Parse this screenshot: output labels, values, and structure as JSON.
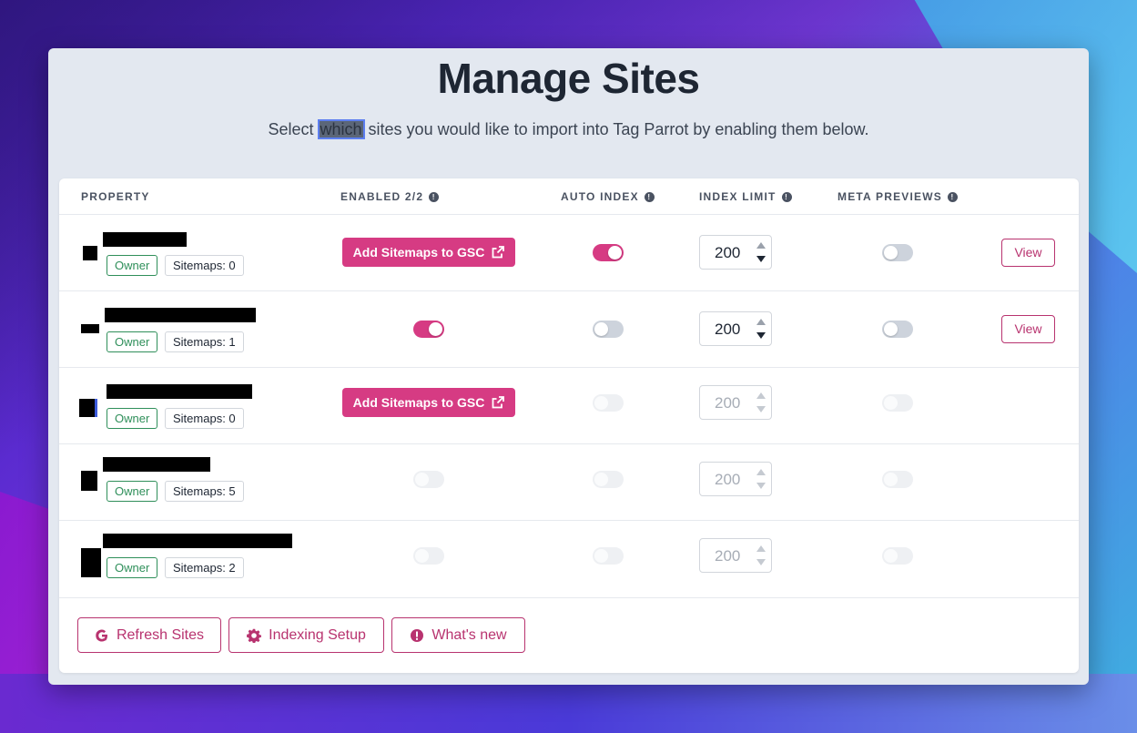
{
  "page": {
    "title": "Manage Sites",
    "subtitle_before": "Select ",
    "subtitle_highlight": "which",
    "subtitle_after": " sites you would like to import into Tag Parrot by enabling them below."
  },
  "table": {
    "headers": {
      "property": "PROPERTY",
      "enabled": "ENABLED 2/2",
      "auto_index": "AUTO INDEX",
      "index_limit": "INDEX LIMIT",
      "meta_previews": "META PREVIEWS"
    },
    "rows": [
      {
        "owner": "Owner",
        "sitemaps": "Sitemaps: 0",
        "gsc_button": "Add Sitemaps to GSC",
        "auto_index": true,
        "limit": "200",
        "meta_previews": false,
        "view": "View"
      },
      {
        "owner": "Owner",
        "sitemaps": "Sitemaps: 1",
        "enabled": true,
        "auto_index": false,
        "limit": "200",
        "meta_previews": false,
        "view": "View"
      },
      {
        "owner": "Owner",
        "sitemaps": "Sitemaps: 0",
        "gsc_button": "Add Sitemaps to GSC",
        "auto_index": false,
        "limit": "200",
        "meta_previews": false
      },
      {
        "owner": "Owner",
        "sitemaps": "Sitemaps: 5",
        "enabled": false,
        "auto_index": false,
        "limit": "200",
        "meta_previews": false
      },
      {
        "owner": "Owner",
        "sitemaps": "Sitemaps: 2",
        "enabled": false,
        "auto_index": false,
        "limit": "200",
        "meta_previews": false
      }
    ]
  },
  "footer": {
    "refresh": "Refresh Sites",
    "indexing": "Indexing Setup",
    "whats_new": "What's new"
  },
  "colors": {
    "accent": "#d63b83",
    "owner_badge": "#2f8f5a"
  }
}
